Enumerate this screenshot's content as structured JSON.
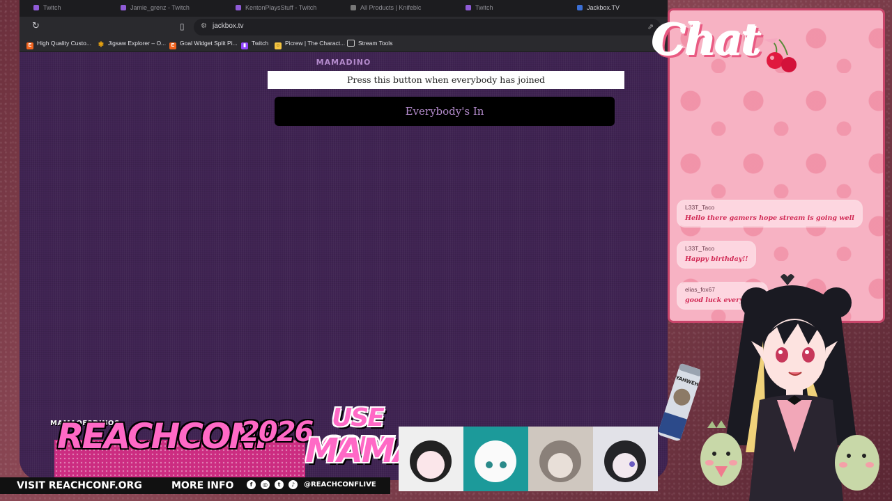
{
  "browser": {
    "tabs": [
      {
        "label": "Twitch",
        "active": false
      },
      {
        "label": "Jamie_grenz - Twitch",
        "active": false
      },
      {
        "label": "KentonPlaysStuff - Twitch",
        "active": false
      },
      {
        "label": "All Products | Knifeblc",
        "active": false
      },
      {
        "label": "Twitch",
        "active": false
      },
      {
        "label": "Jackbox.TV",
        "active": true
      }
    ],
    "url": "jackbox.tv",
    "bookmarks": [
      {
        "label": "High Quality Custo...",
        "icon": "etsy-icon",
        "color": "#f1641e",
        "glyph": "E"
      },
      {
        "label": "Jigsaw Explorer – O...",
        "icon": "jigsaw-icon",
        "color": "#e4a010",
        "glyph": "✱"
      },
      {
        "label": "Goal Widget Split Pi...",
        "icon": "etsy-icon",
        "color": "#f1641e",
        "glyph": "E"
      },
      {
        "label": "Twitch",
        "icon": "twitch-icon",
        "color": "#9146ff",
        "glyph": "▮"
      },
      {
        "label": "Picrew | The Charact...",
        "icon": "picrew-icon",
        "color": "#f5c542",
        "glyph": "☺"
      },
      {
        "label": "Stream Tools",
        "icon": "folder-icon",
        "color": "#3a3a3e",
        "glyph": "▭"
      }
    ]
  },
  "jackbox": {
    "player_name": "MAMADINO",
    "instruction": "Press this button when everybody has joined",
    "button_label": "Everybody's In"
  },
  "chat": {
    "title": "Chat",
    "messages": [
      {
        "user": "L33T_Taco",
        "text": "Hello there gamers hope stream is going well"
      },
      {
        "user": "L33T_Taco",
        "text": "Happy birthday!!"
      },
      {
        "user": "elias_fox67",
        "text": "good luck everyone!"
      }
    ]
  },
  "overlay": {
    "creator": "MAMAOF3DINOS",
    "event": "REACHCONF",
    "year": "2026",
    "code_line1": "USE CODE",
    "code_line2": "MAMA",
    "visit": "VISIT REACHCONF.ORG",
    "more_info": "MORE INFO",
    "handle": "@REACHCONFLIVE",
    "can_label": "YAHWEH"
  },
  "colors": {
    "accent_pink": "#ff69c6",
    "jackbox_purple": "#3f2352",
    "jackbox_text": "#b48bcc",
    "chat_bg": "#f7b2c3"
  }
}
